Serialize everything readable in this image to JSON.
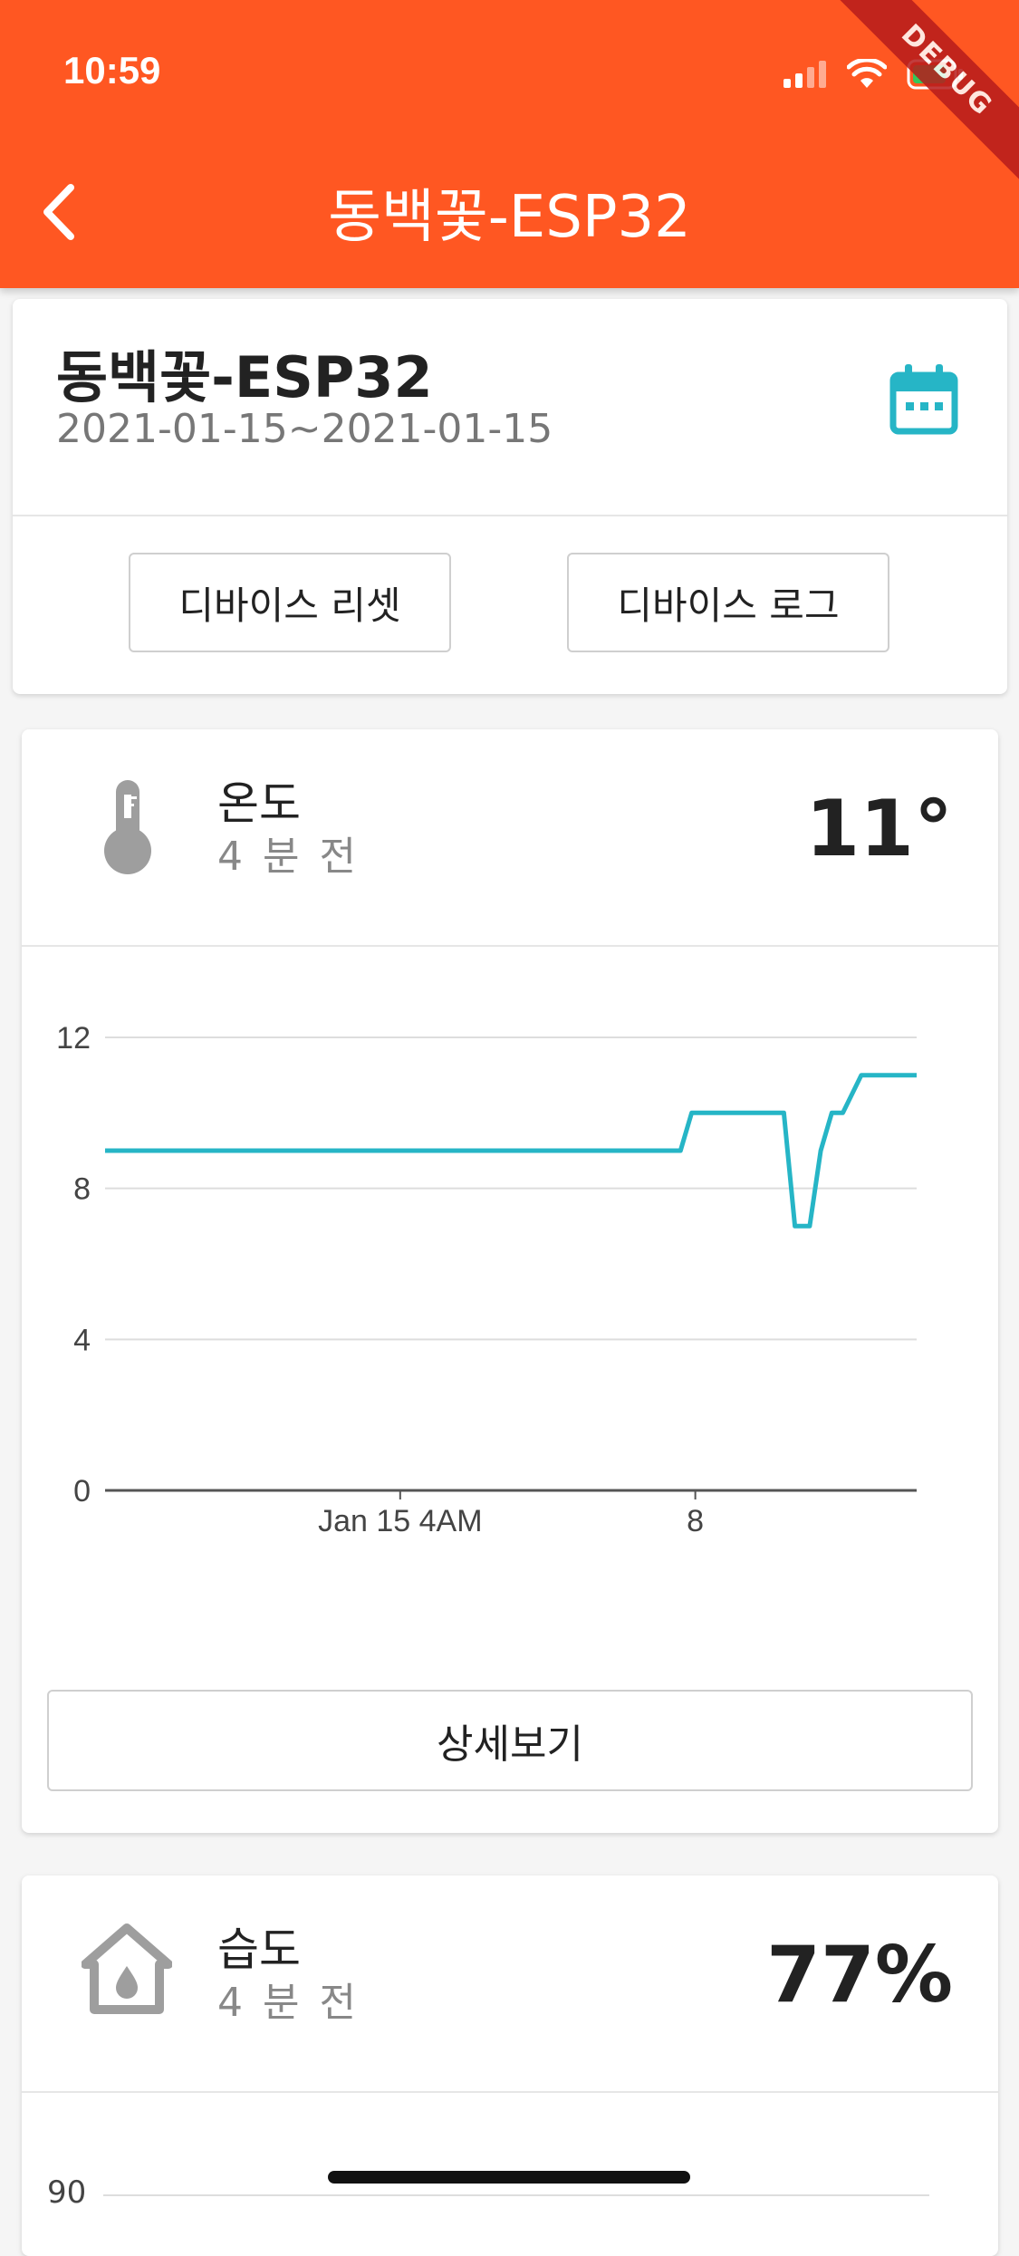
{
  "status_bar": {
    "time": "10:59"
  },
  "appbar": {
    "title": "동백꽃-ESP32",
    "debug_banner": "DEBUG"
  },
  "device": {
    "name": "동백꽃-ESP32",
    "date_range": "2021-01-15~2021-01-15",
    "reset_label": "디바이스 리셋",
    "log_label": "디바이스 로그"
  },
  "temperature": {
    "name": "온도",
    "ago": "4 분 전",
    "value": "11°",
    "detail_label": "상세보기"
  },
  "humidity": {
    "name": "습도",
    "ago": "4 분 전",
    "value": "77%",
    "first_tick": "90"
  },
  "colors": {
    "appbar": "#ff5722",
    "accent": "#26b5c6",
    "grid": "#dddddd"
  },
  "icons": [
    "back-arrow-icon",
    "calendar-icon",
    "thermometer-icon",
    "humidity-house-icon",
    "signal-icon",
    "wifi-icon",
    "battery-icon"
  ],
  "chart_data": {
    "type": "line",
    "title": "",
    "xlabel": "",
    "ylabel": "",
    "ylim": [
      0,
      12
    ],
    "yticks": [
      "0",
      "4",
      "8",
      "12"
    ],
    "xlim": [
      0,
      11
    ],
    "xticks": [
      {
        "x": 4,
        "label": "Jan 15 4AM"
      },
      {
        "x": 8,
        "label": "8"
      }
    ],
    "grid": true,
    "series": [
      {
        "color": "#26b5c6",
        "points": [
          [
            0,
            9
          ],
          [
            7.8,
            9
          ],
          [
            7.95,
            10
          ],
          [
            9.2,
            10
          ],
          [
            9.35,
            7
          ],
          [
            9.55,
            7
          ],
          [
            9.7,
            9
          ],
          [
            9.85,
            10
          ],
          [
            10.0,
            10
          ],
          [
            10.25,
            11
          ],
          [
            11,
            11
          ]
        ]
      }
    ]
  }
}
